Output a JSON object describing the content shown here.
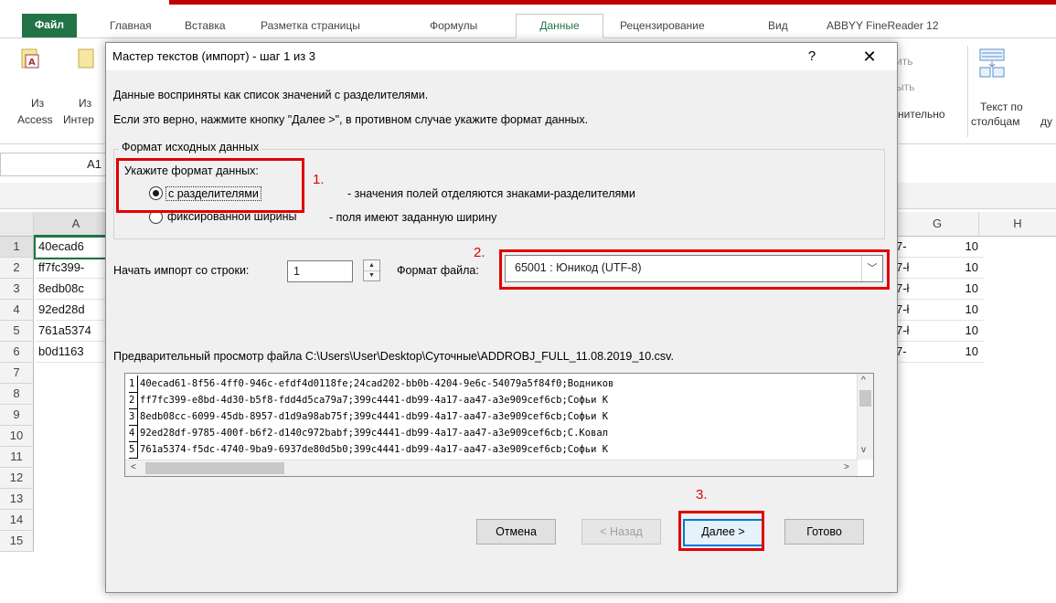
{
  "excel": {
    "tabs": [
      "Файл",
      "Главная",
      "Вставка",
      "Разметка страницы",
      "Формулы",
      "Данные",
      "Рецензирование",
      "Вид",
      "ABBYY FineReader 12"
    ],
    "ribbon": {
      "from_access_1": "Из",
      "from_access_2": "Access",
      "from_internet_1": "Из",
      "from_internet_2": "Интер",
      "partial_1": "ить",
      "partial_2": "ыть",
      "partial_3": "нительно",
      "text_to_columns_1": "Текст по",
      "text_to_columns_2": "столбцам",
      "text_to_columns_3": "ду"
    },
    "namebox": "A1",
    "columns": [
      "A",
      "G",
      "H"
    ],
    "rows": [
      "1",
      "2",
      "3",
      "4",
      "5",
      "6",
      "7",
      "8",
      "9",
      "10",
      "11",
      "12",
      "13",
      "14",
      "15"
    ],
    "col_a": [
      "40ecad6",
      "ff7fc399-",
      "8edb08c",
      "92ed28d",
      "761a5374",
      "b0d1163"
    ],
    "col_f_partial": [
      "7-",
      "7-ł",
      "7-ł",
      "7-ł",
      "7-ł",
      "7-"
    ],
    "col_g": [
      "10",
      "10",
      "10",
      "10",
      "10",
      "10"
    ]
  },
  "dialog": {
    "title": "Мастер текстов (импорт) - шаг 1 из 3",
    "help": "?",
    "close": "✕",
    "line1": "Данные восприняты как список значений с разделителями.",
    "line2": "Если это верно, нажмите кнопку \"Далее >\", в противном случае укажите формат данных.",
    "group_label": "Формат исходных данных",
    "specify_label": "Укажите формат данных:",
    "radio_delimited": "с разделителями",
    "radio_delimited_desc": "- значения полей отделяются знаками-разделителями",
    "radio_fixed": "фиксированной ширины",
    "radio_fixed_desc": "- поля имеют заданную ширину",
    "start_label": "Начать импорт со строки:",
    "start_value": "1",
    "format_label": "Формат файла:",
    "format_value": "65001 : Юникод (UTF-8)",
    "preview_label": "Предварительный просмотр файла C:\\Users\\User\\Desktop\\Суточные\\ADDROBJ_FULL_11.08.2019_10.csv.",
    "preview_lines": [
      {
        "n": "1",
        "text": "40ecad61-8f56-4ff0-946c-efdf4d0118fe;24cad202-bb0b-4204-9e6c-54079a5f84f0;Водников"
      },
      {
        "n": "2",
        "text": "ff7fc399-e8bd-4d30-b5f8-fdd4d5ca79a7;399c4441-db99-4a17-aa47-a3e909cef6cb;Софьи К"
      },
      {
        "n": "3",
        "text": "8edb08cc-6099-45db-8957-d1d9a98ab75f;399c4441-db99-4a17-aa47-a3e909cef6cb;Софьи К"
      },
      {
        "n": "4",
        "text": "92ed28df-9785-400f-b6f2-d140c972babf;399c4441-db99-4a17-aa47-a3e909cef6cb;С.Ковал"
      },
      {
        "n": "5",
        "text": "761a5374-f5dc-4740-9ba9-6937de80d5b0;399c4441-db99-4a17-aa47-a3e909cef6cb;Софьи К"
      }
    ],
    "buttons": {
      "cancel": "Отмена",
      "back": "< Назад",
      "next": "Далее >",
      "finish": "Готово"
    },
    "annotations": {
      "a1": "1.",
      "a2": "2.",
      "a3": "3."
    }
  },
  "colors": {
    "excel_green": "#217346",
    "annotation_red": "#e00000",
    "dialog_bg": "#f0f0f0",
    "default_button_border": "#0078d7"
  }
}
